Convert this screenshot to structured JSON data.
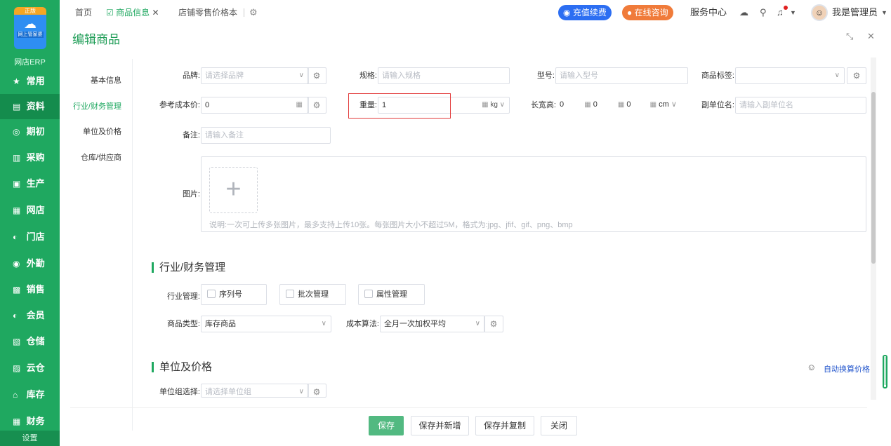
{
  "sidebar": {
    "logo_tag": "正版",
    "logo_mini": "网上管家婆",
    "app_name": "网店ERP",
    "items": [
      {
        "label": "常用",
        "icon": "★"
      },
      {
        "label": "资料",
        "icon": "▤"
      },
      {
        "label": "期初",
        "icon": "◎"
      },
      {
        "label": "采购",
        "icon": "▥"
      },
      {
        "label": "生产",
        "icon": "▣"
      },
      {
        "label": "网店",
        "icon": "▦"
      },
      {
        "label": "门店",
        "icon": "◐"
      },
      {
        "label": "外勤",
        "icon": "◉"
      },
      {
        "label": "销售",
        "icon": "▩"
      },
      {
        "label": "会员",
        "icon": "◐"
      },
      {
        "label": "仓储",
        "icon": "▧"
      },
      {
        "label": "云仓",
        "icon": "▨"
      },
      {
        "label": "库存",
        "icon": "⌂"
      },
      {
        "label": "财务",
        "icon": "▦"
      }
    ],
    "setting": "设置"
  },
  "topbar": {
    "tabs": [
      "首页",
      "商品信息",
      "店铺零售价格本"
    ],
    "recharge": "充值续费",
    "consult": "在线咨询",
    "service": "服务中心",
    "user": "我是管理员"
  },
  "page": {
    "title": "编辑商品",
    "anchors": [
      "基本信息",
      "行业/财务管理",
      "单位及价格",
      "仓库/供应商"
    ]
  },
  "form": {
    "brand_label": "品牌:",
    "brand_ph": "请选择品牌",
    "spec_label": "规格:",
    "spec_ph": "请输入规格",
    "model_label": "型号:",
    "model_ph": "请输入型号",
    "tag_label": "商品标签:",
    "cost_label": "参考成本价:",
    "cost_value": "0",
    "weight_label": "重量:",
    "weight_value": "1",
    "weight_unit": "kg",
    "dims_label": "长宽高:",
    "dim_l": "0",
    "dim_w": "0",
    "dim_h": "0",
    "dim_unit": "cm",
    "subunit_label": "副单位名:",
    "subunit_ph": "请输入副单位名",
    "remark_label": "备注:",
    "remark_ph": "请输入备注",
    "image_label": "图片:",
    "image_hint": "说明:一次可上传多张图片，最多支持上传10张。每张图片大小不超过5M，格式为:jpg、jfif、gif、png、bmp"
  },
  "industry": {
    "title": "行业/财务管理",
    "mgmt_label": "行业管理:",
    "options": [
      "序列号",
      "批次管理",
      "属性管理"
    ],
    "type_label": "商品类型:",
    "type_value": "库存商品",
    "cost_method_label": "成本算法:",
    "cost_method_value": "全月一次加权平均"
  },
  "units": {
    "title": "单位及价格",
    "auto_label": "自动换算价格",
    "group_label": "单位组选择:",
    "group_ph": "请选择单位组"
  },
  "footer": {
    "save": "保存",
    "save_new": "保存并新增",
    "save_copy": "保存并复制",
    "close": "关闭"
  }
}
